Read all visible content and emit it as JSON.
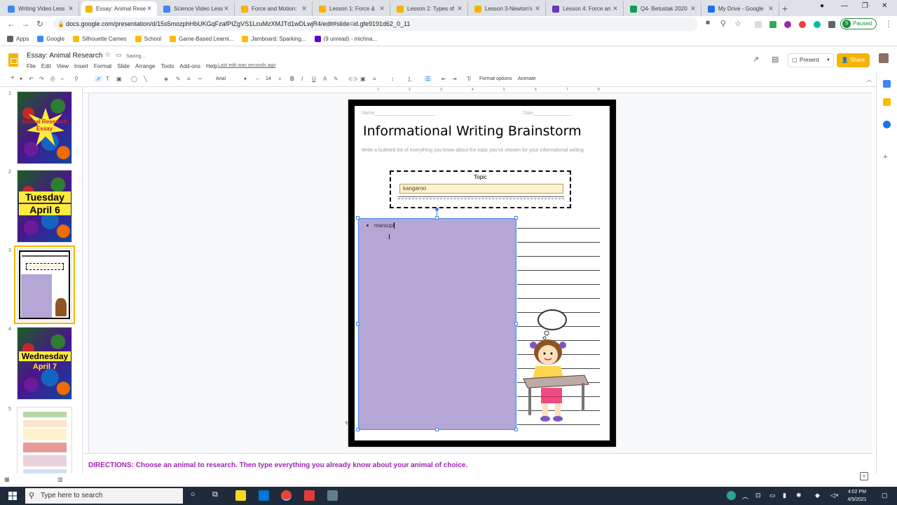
{
  "browser": {
    "tabs": [
      {
        "title": "Writing Video Less",
        "color": "#4285f4"
      },
      {
        "title": "Essay: Animal Rese",
        "color": "#f4b400"
      },
      {
        "title": "Science Video Less",
        "color": "#4285f4"
      },
      {
        "title": "Force and Motion:",
        "color": "#f4b400"
      },
      {
        "title": "Lesson 1: Force &",
        "color": "#f4b400"
      },
      {
        "title": "Lesson 2: Types of",
        "color": "#f4b400"
      },
      {
        "title": "Lesson 3-Newton's",
        "color": "#f4b400"
      },
      {
        "title": "Lesson 4: Force an",
        "color": "#673ab7"
      },
      {
        "title": "Q4- Betustak 2020",
        "color": "#0f9d58"
      },
      {
        "title": "My Drive - Google",
        "color": "#1a73e8"
      }
    ],
    "url": "docs.google.com/presentation/d/15s5mozphHbUKGqFzafPIZgVS1LcuMzXMJTd1wDLwjR4/edit#slide=id.gfe9191d62_0_11",
    "profile_status": "Paused",
    "profile_initial": "S",
    "bookmarks": [
      {
        "label": "Apps",
        "color": "#5f6368"
      },
      {
        "label": "Google",
        "color": "#4285f4"
      },
      {
        "label": "Silhouette Cameo",
        "color": "#fbbc04"
      },
      {
        "label": "School",
        "color": "#fbbc04"
      },
      {
        "label": "Game-Based Learni...",
        "color": "#fbbc04"
      },
      {
        "label": "Jamboard: Sparking...",
        "color": "#fbbc04"
      },
      {
        "label": "(9 unread) - michna...",
        "color": "#6001d2"
      }
    ]
  },
  "app": {
    "doc_title": "Essay: Animal Research",
    "save_status": "Saving...",
    "menus": [
      "File",
      "Edit",
      "View",
      "Insert",
      "Format",
      "Slide",
      "Arrange",
      "Tools",
      "Add-ons",
      "Help"
    ],
    "last_edit": "Last edit was seconds ago",
    "present_label": "Present",
    "share_label": "Share"
  },
  "toolbar": {
    "font": "Arial",
    "font_size": "14",
    "format_options": "Format options",
    "animate": "Animate"
  },
  "ruler_ticks": [
    "1",
    "2",
    "3",
    "4",
    "5",
    "6",
    "7",
    "8"
  ],
  "filmstrip": [
    {
      "num": "1",
      "kind": "burst",
      "text": "Animal Research Essay"
    },
    {
      "num": "2",
      "kind": "day",
      "line1": "Tuesday",
      "line2": "April 6"
    },
    {
      "num": "3",
      "kind": "current"
    },
    {
      "num": "4",
      "kind": "day",
      "line1": "Wednesday",
      "line2": "April 7"
    },
    {
      "num": "5",
      "kind": "organizer"
    }
  ],
  "slide": {
    "name_label": "Name______________________",
    "date_label": "Date______________",
    "title": "Informational Writing Brainstorm",
    "instructions": "Write a bulleted list of everything you know about the topic you've chosen for your informational writing.",
    "topic_label": "Topic",
    "topic_value": "kangaroo",
    "bullet_text": "marsupi"
  },
  "notes": {
    "text": "DIRECTIONS:  Choose an animal to research. Then type everything you already know about your animal of choice."
  },
  "taskbar": {
    "search_placeholder": "Type here to search",
    "time": "4:02 PM",
    "date": "4/5/2021"
  }
}
